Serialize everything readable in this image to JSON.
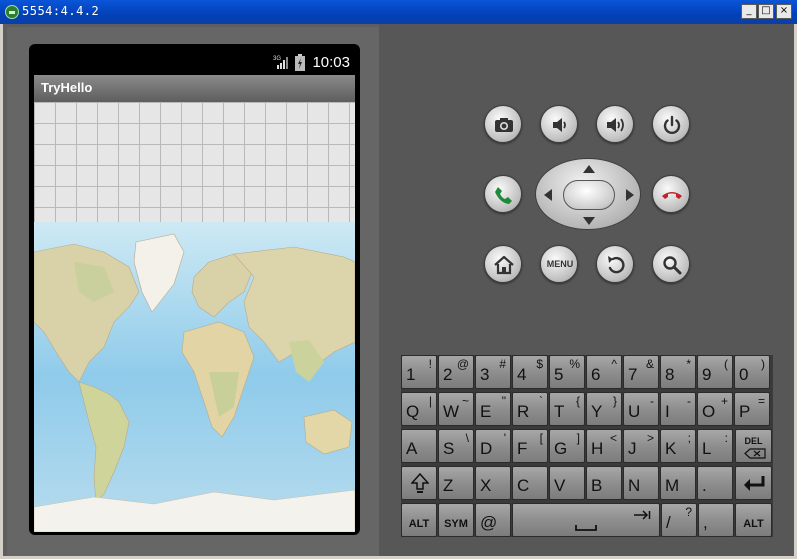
{
  "window": {
    "title": "5554:4.4.2",
    "minimize": "_",
    "maximize": "□",
    "close": "×"
  },
  "device": {
    "clock": "10:03",
    "network": "3G",
    "app_title": "TryHello"
  },
  "controls": {
    "menu_label": "MENU"
  },
  "keyboard": {
    "row1": [
      {
        "main": "1",
        "sec": "!"
      },
      {
        "main": "2",
        "sec": "@"
      },
      {
        "main": "3",
        "sec": "#"
      },
      {
        "main": "4",
        "sec": "$"
      },
      {
        "main": "5",
        "sec": "%"
      },
      {
        "main": "6",
        "sec": "^"
      },
      {
        "main": "7",
        "sec": "&"
      },
      {
        "main": "8",
        "sec": "*"
      },
      {
        "main": "9",
        "sec": "("
      },
      {
        "main": "0",
        "sec": ")"
      }
    ],
    "row2": [
      {
        "main": "Q",
        "sec": "|"
      },
      {
        "main": "W",
        "sec": "~"
      },
      {
        "main": "E",
        "sec": "\""
      },
      {
        "main": "R",
        "sec": "`"
      },
      {
        "main": "T",
        "sec": "{"
      },
      {
        "main": "Y",
        "sec": "}"
      },
      {
        "main": "U",
        "sec": "-"
      },
      {
        "main": "I",
        "sec": "-"
      },
      {
        "main": "O",
        "sec": "+"
      },
      {
        "main": "P",
        "sec": "="
      }
    ],
    "row3": [
      {
        "main": "A",
        "sec": ""
      },
      {
        "main": "S",
        "sec": "\\"
      },
      {
        "main": "D",
        "sec": "'"
      },
      {
        "main": "F",
        "sec": "["
      },
      {
        "main": "G",
        "sec": "]"
      },
      {
        "main": "H",
        "sec": "<"
      },
      {
        "main": "J",
        "sec": ">"
      },
      {
        "main": "K",
        "sec": ";"
      },
      {
        "main": "L",
        "sec": ":"
      }
    ],
    "row3_del": "DEL",
    "row4": [
      {
        "main": "Z",
        "sec": ""
      },
      {
        "main": "X",
        "sec": ""
      },
      {
        "main": "C",
        "sec": ""
      },
      {
        "main": "V",
        "sec": ""
      },
      {
        "main": "B",
        "sec": ""
      },
      {
        "main": "N",
        "sec": ""
      },
      {
        "main": "M",
        "sec": ""
      },
      {
        "main": ".",
        "sec": ""
      }
    ],
    "alt_left": "ALT",
    "sym": "SYM",
    "at": "@",
    "slash_main": "/",
    "slash_sec": "?",
    "comma": ",",
    "alt_right": "ALT"
  }
}
